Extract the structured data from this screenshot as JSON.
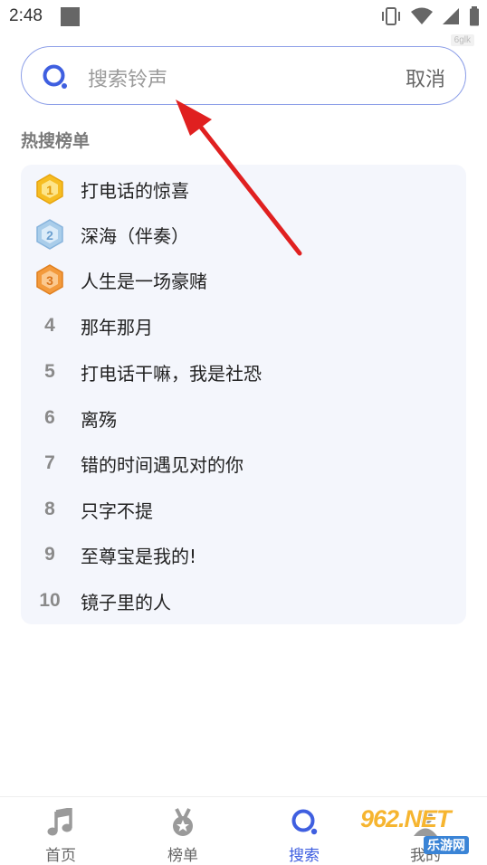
{
  "status_bar": {
    "time": "2:48"
  },
  "watermark_tag": "6glk",
  "search": {
    "placeholder": "搜索铃声",
    "cancel_label": "取消"
  },
  "hot_section": {
    "title": "热搜榜单",
    "items": [
      {
        "rank": "1",
        "title": "打电话的惊喜"
      },
      {
        "rank": "2",
        "title": "深海（伴奏）"
      },
      {
        "rank": "3",
        "title": "人生是一场豪赌"
      },
      {
        "rank": "4",
        "title": "那年那月"
      },
      {
        "rank": "5",
        "title": "打电话干嘛，我是社恐"
      },
      {
        "rank": "6",
        "title": "离殇"
      },
      {
        "rank": "7",
        "title": "错的时间遇见对的你"
      },
      {
        "rank": "8",
        "title": "只字不提"
      },
      {
        "rank": "9",
        "title": "至尊宝是我的!"
      },
      {
        "rank": "10",
        "title": "镜子里的人"
      }
    ],
    "badge_colors": {
      "gold": "#f6bd22",
      "silver": "#9cc3e8",
      "bronze": "#f39a3c"
    }
  },
  "bottom_nav": {
    "items": [
      {
        "label": "首页",
        "icon": "music-note-icon"
      },
      {
        "label": "榜单",
        "icon": "medal-icon"
      },
      {
        "label": "搜索",
        "icon": "search-icon",
        "active": true
      },
      {
        "label": "我的",
        "icon": "user-icon"
      }
    ]
  },
  "watermark": {
    "brand": "962.NET",
    "sub": "乐游网"
  },
  "colors": {
    "accent": "#3f5fe0",
    "search_border": "#8d9fe8",
    "arrow": "#e02020",
    "card_bg": "#f4f6fc"
  }
}
